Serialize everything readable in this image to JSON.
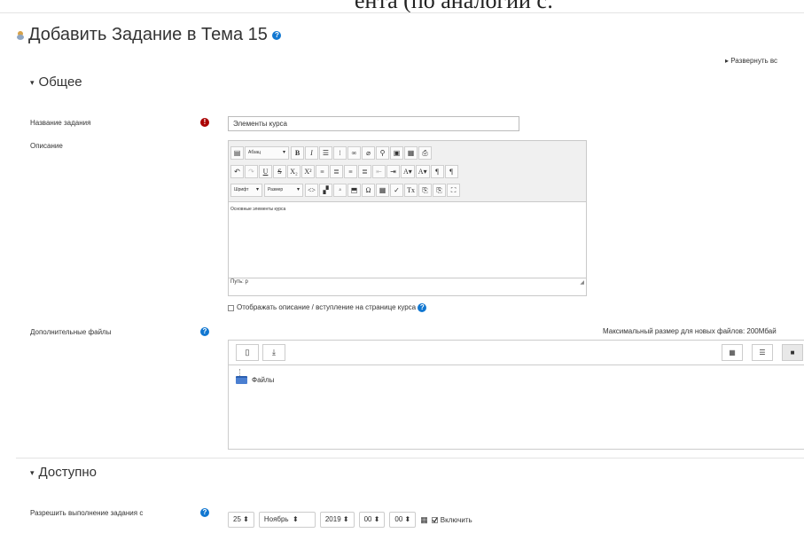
{
  "top_fragment": "ента (по аналогии с:",
  "page": {
    "title": "Добавить Задание в Тема 15",
    "expand_all": "▸ Развернуть вс"
  },
  "sections": {
    "general": "Общее",
    "availability": "Доступно"
  },
  "fields": {
    "name_label": "Название задания",
    "name_value": "Элементы курса",
    "description_label": "Описание",
    "files_label": "Дополнительные файлы",
    "allow_from_label": "Разрешить выполнение задания с"
  },
  "editor": {
    "format_select": "Абзац",
    "font_select": "Шрифт",
    "size_select": "Размер",
    "row1": [
      "▤",
      "B",
      "I",
      "☰",
      "⁝☰",
      "🔗",
      "⛓",
      "⚲",
      "▣",
      "▦",
      "⎙"
    ],
    "row2": [
      "↶",
      "↷",
      "U",
      "S",
      "X₂",
      "X²",
      "≡",
      "≣",
      "≡",
      "≡",
      "⇤",
      "⇥",
      "A",
      "▾",
      "A",
      "▾",
      "¶",
      "¶"
    ],
    "row3": [
      "<>",
      "▞",
      "ᵃ",
      "⬒",
      "Ω",
      "▦",
      "✓",
      "Tx",
      "⎘",
      "⎘",
      "⛶"
    ],
    "body_text": "Основные элементы курса",
    "path": "Путь: p"
  },
  "show_description": "Отображать описание / вступление на странице курса",
  "files": {
    "max_size": "Максимальный размер для новых файлов: 200Мбай",
    "root_folder": "Файлы"
  },
  "date": {
    "day": "25",
    "month": "Ноябрь",
    "year": "2019",
    "hour": "00",
    "minute": "00",
    "enable_label": "Включить",
    "enabled": true
  },
  "colors": {
    "help_blue": "#1177d1",
    "required_red": "#aa0000",
    "folder_blue": "#4a7fd1"
  }
}
